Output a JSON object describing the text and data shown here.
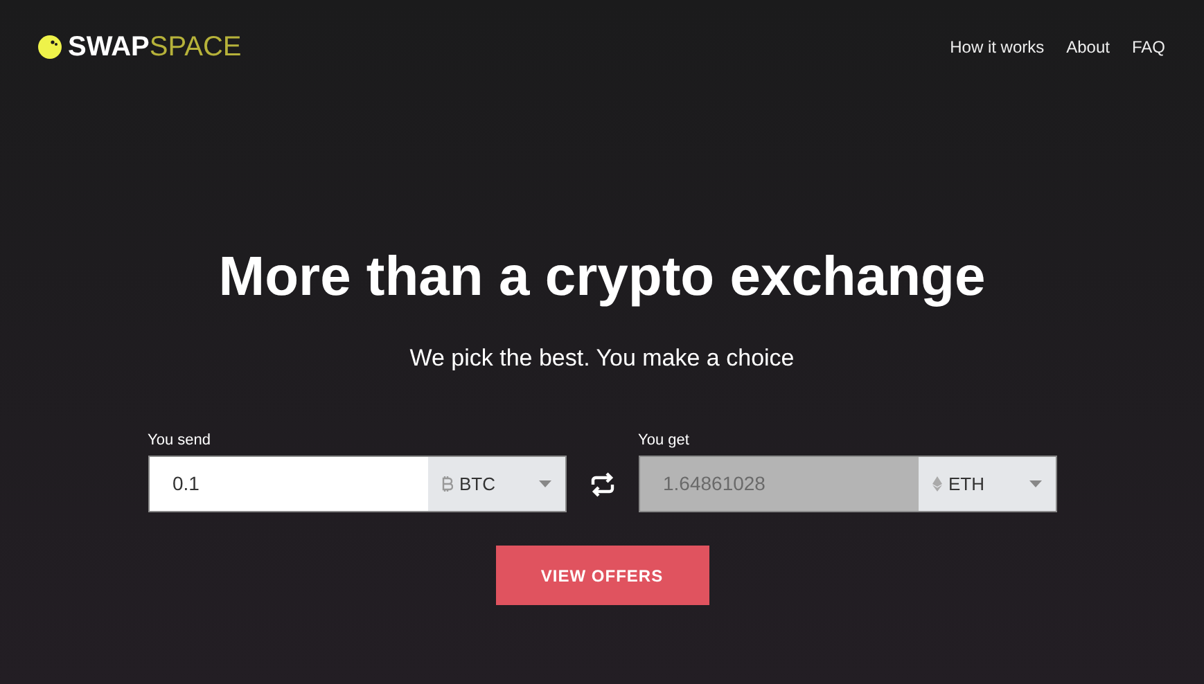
{
  "logo": {
    "bold": "SWAP",
    "light": "SPACE"
  },
  "nav": [
    "How it works",
    "About",
    "FAQ"
  ],
  "hero": {
    "title": "More than a crypto exchange",
    "subtitle": "We pick the best. You make a choice"
  },
  "exchange": [
    {
      "label": "You send",
      "value": "0.1",
      "currency": "BTC",
      "kind": "btc",
      "disabled": false
    },
    {
      "label": "You get",
      "value": "1.64861028",
      "currency": "ETH",
      "kind": "eth",
      "disabled": true
    }
  ],
  "button": "VIEW OFFERS"
}
